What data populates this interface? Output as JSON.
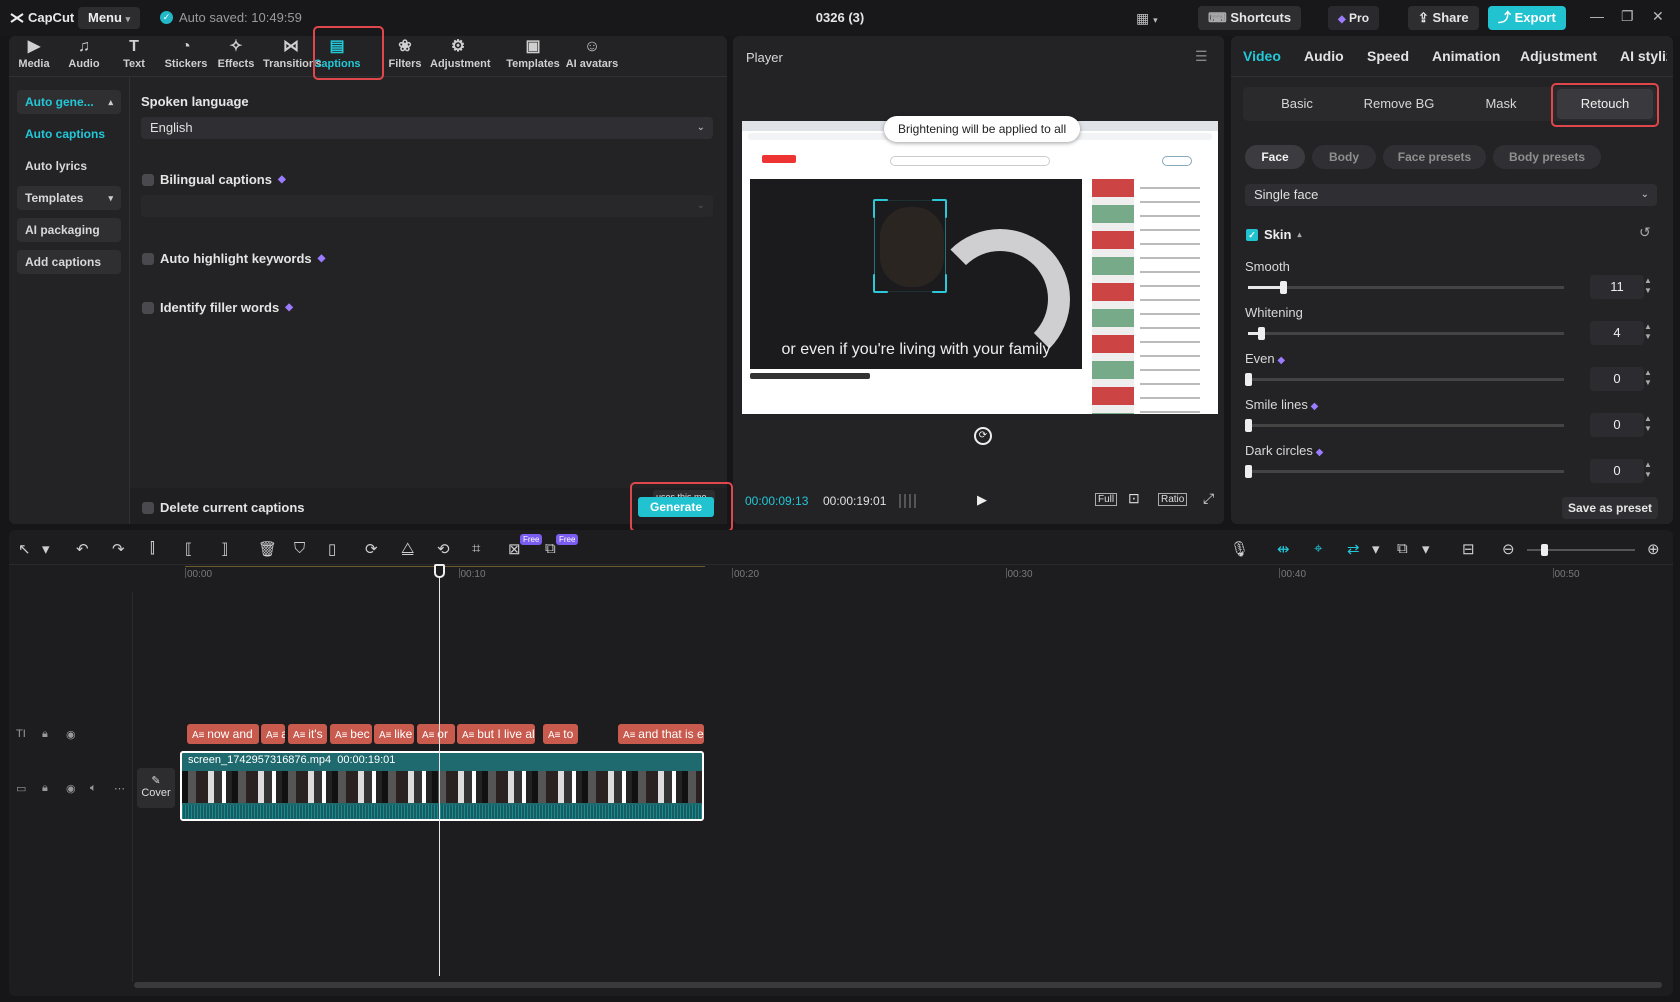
{
  "titlebar": {
    "logo": "CapCut",
    "menu": "Menu",
    "autosave": "Auto saved: 10:49:59",
    "doc_title": "0326 (3)",
    "shortcuts": "Shortcuts",
    "pro": "Pro",
    "share": "Share",
    "export": "Export"
  },
  "toolbar": {
    "items": [
      {
        "label": "Media",
        "icon": "media-icon"
      },
      {
        "label": "Audio",
        "icon": "audio-icon"
      },
      {
        "label": "Text",
        "icon": "text-icon"
      },
      {
        "label": "Stickers",
        "icon": "stickers-icon"
      },
      {
        "label": "Effects",
        "icon": "effects-icon"
      },
      {
        "label": "Transitions",
        "icon": "transitions-icon"
      },
      {
        "label": "Captions",
        "icon": "captions-icon",
        "active": true
      },
      {
        "label": "Filters",
        "icon": "filters-icon"
      },
      {
        "label": "Adjustment",
        "icon": "adjustment-icon"
      },
      {
        "label": "Templates",
        "icon": "templates-icon"
      },
      {
        "label": "AI avatars",
        "icon": "ai-avatars-icon"
      }
    ]
  },
  "sidebar": {
    "items": [
      {
        "label": "Auto gene...",
        "active": true
      },
      {
        "label": "Auto captions",
        "active": true
      },
      {
        "label": "Auto lyrics"
      },
      {
        "label": "Templates"
      },
      {
        "label": "AI packaging"
      },
      {
        "label": "Add captions"
      }
    ]
  },
  "captions_panel": {
    "spoken_language_label": "Spoken language",
    "spoken_language_value": "English",
    "bilingual": "Bilingual captions",
    "highlight": "Auto highlight keywords",
    "filler": "Identify filler words",
    "delete_current": "Delete current captions",
    "generate_hint": "uses this mo",
    "generate": "Generate"
  },
  "player": {
    "title": "Player",
    "toast": "Brightening will be applied to all",
    "subtitle": "or even if you're living with your family",
    "current_time": "00:00:09:13",
    "total_time": "00:00:19:01",
    "full": "Full",
    "ratio": "Ratio"
  },
  "right_panel": {
    "tabs": [
      "Video",
      "Audio",
      "Speed",
      "Animation",
      "Adjustment",
      "AI stylize"
    ],
    "segments": [
      "Basic",
      "Remove BG",
      "Mask",
      "Retouch"
    ],
    "pills": [
      "Face",
      "Body",
      "Face presets",
      "Body presets"
    ],
    "face_mode": "Single face",
    "skin": "Skin",
    "sliders": [
      {
        "label": "Smooth",
        "value": "11",
        "pct": 11,
        "premium": false
      },
      {
        "label": "Whitening",
        "value": "4",
        "pct": 4,
        "premium": false
      },
      {
        "label": "Even",
        "value": "0",
        "pct": 0,
        "premium": true
      },
      {
        "label": "Smile lines",
        "value": "0",
        "pct": 0,
        "premium": true
      },
      {
        "label": "Dark circles",
        "value": "0",
        "pct": 0,
        "premium": true
      }
    ],
    "save_preset": "Save as preset"
  },
  "timeline": {
    "ruler": [
      "00:00",
      "00:10",
      "00:20",
      "00:30",
      "00:40",
      "00:50"
    ],
    "free_badge": "Free",
    "captions": [
      "now and",
      "a",
      "it's",
      "bec",
      "like",
      "or",
      "but I live al",
      "to",
      "and that is e"
    ],
    "video_clip": {
      "name": "screen_1742957316876.mp4",
      "duration": "00:00:19:01"
    },
    "cover": "Cover"
  },
  "colors": {
    "accent": "#22c8d8",
    "highlight_box": "#e0474c",
    "caption_clip": "#c85a4e",
    "video_clip": "#1e6a6e"
  }
}
